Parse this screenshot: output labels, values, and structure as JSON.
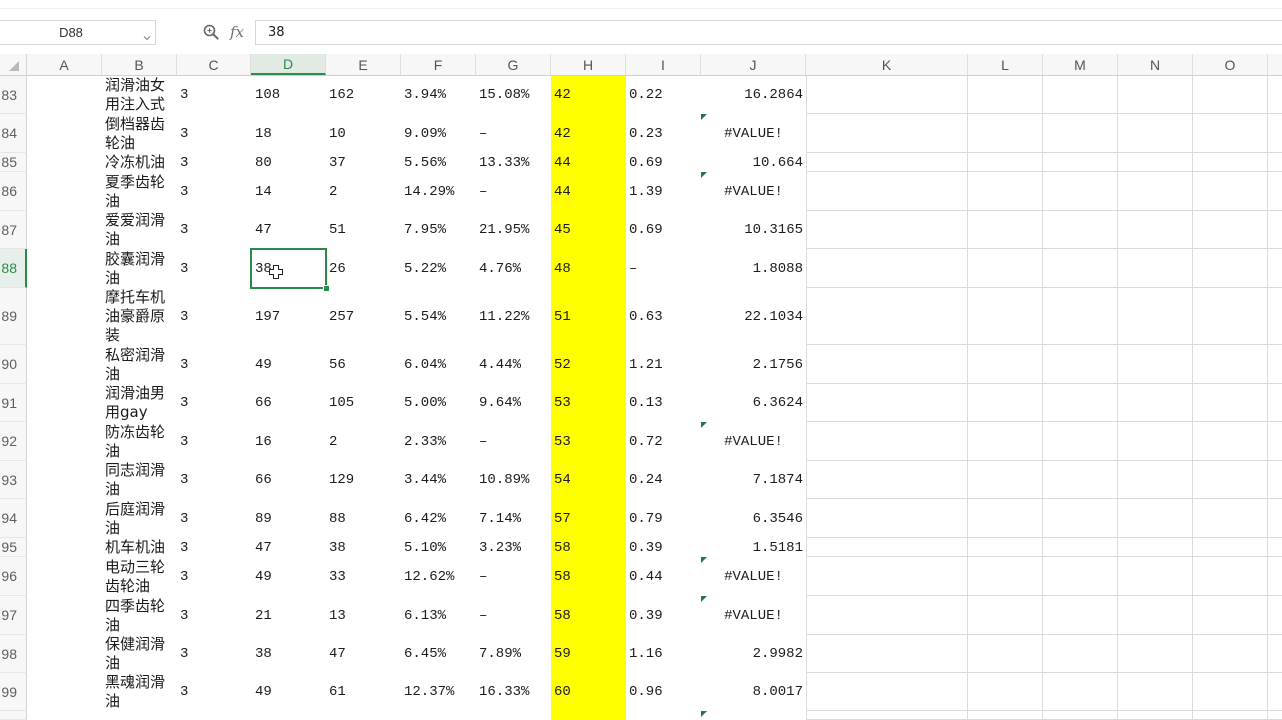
{
  "name_box": {
    "value": "D88"
  },
  "formula_bar": {
    "fx_label": "fx",
    "value": "38"
  },
  "icons": {
    "name_box_dropdown": "chevron-down-icon",
    "zoom": "zoom-icon",
    "select_all": "select-all-triangle-icon",
    "error_indicator": "error-indicator-icon",
    "pointer": "cell-select-cursor-icon"
  },
  "colors": {
    "accent": "#2a8a4a",
    "highlight_fill": "#ffff00",
    "error_indicator": "#1f7a3d"
  },
  "column_headers": [
    "A",
    "B",
    "C",
    "D",
    "E",
    "F",
    "G",
    "H",
    "I",
    "J",
    "K",
    "L",
    "M",
    "N",
    "O"
  ],
  "rows": [
    {
      "row": "83",
      "B": "润滑油女用注入式",
      "C": "3",
      "D": "108",
      "E": "162",
      "F": "3.94%",
      "G": "15.08%",
      "H": "42",
      "I": "0.22",
      "J": "16.2864",
      "flag": false
    },
    {
      "row": "84",
      "B": "倒档器齿轮油",
      "C": "3",
      "D": "18",
      "E": "10",
      "F": "9.09%",
      "G": "–",
      "H": "42",
      "I": "0.23",
      "J": "#VALUE!",
      "flag": true
    },
    {
      "row": "85",
      "B": "冷冻机油",
      "C": "3",
      "D": "80",
      "E": "37",
      "F": "5.56%",
      "G": "13.33%",
      "H": "44",
      "I": "0.69",
      "J": "10.664",
      "flag": false
    },
    {
      "row": "86",
      "B": "夏季齿轮油",
      "C": "3",
      "D": "14",
      "E": "2",
      "F": "14.29%",
      "G": "–",
      "H": "44",
      "I": "1.39",
      "J": "#VALUE!",
      "flag": true
    },
    {
      "row": "87",
      "B": "爱爱润滑油",
      "C": "3",
      "D": "47",
      "E": "51",
      "F": "7.95%",
      "G": "21.95%",
      "H": "45",
      "I": "0.69",
      "J": "10.3165",
      "flag": false
    },
    {
      "row": "88",
      "B": "胶囊润滑油",
      "C": "3",
      "D": "38",
      "E": "26",
      "F": "5.22%",
      "G": "4.76%",
      "H": "48",
      "I": "–",
      "J": "1.8088",
      "flag": false
    },
    {
      "row": "89",
      "B": "摩托车机油豪爵原装",
      "C": "3",
      "D": "197",
      "E": "257",
      "F": "5.54%",
      "G": "11.22%",
      "H": "51",
      "I": "0.63",
      "J": "22.1034",
      "flag": false
    },
    {
      "row": "90",
      "B": "私密润滑油",
      "C": "3",
      "D": "49",
      "E": "56",
      "F": "6.04%",
      "G": "4.44%",
      "H": "52",
      "I": "1.21",
      "J": "2.1756",
      "flag": false
    },
    {
      "row": "91",
      "B": "润滑油男用gay",
      "C": "3",
      "D": "66",
      "E": "105",
      "F": "5.00%",
      "G": "9.64%",
      "H": "53",
      "I": "0.13",
      "J": "6.3624",
      "flag": false
    },
    {
      "row": "92",
      "B": "防冻齿轮油",
      "C": "3",
      "D": "16",
      "E": "2",
      "F": "2.33%",
      "G": "–",
      "H": "53",
      "I": "0.72",
      "J": "#VALUE!",
      "flag": true
    },
    {
      "row": "93",
      "B": "同志润滑油",
      "C": "3",
      "D": "66",
      "E": "129",
      "F": "3.44%",
      "G": "10.89%",
      "H": "54",
      "I": "0.24",
      "J": "7.1874",
      "flag": false
    },
    {
      "row": "94",
      "B": "后庭润滑油",
      "C": "3",
      "D": "89",
      "E": "88",
      "F": "6.42%",
      "G": "7.14%",
      "H": "57",
      "I": "0.79",
      "J": "6.3546",
      "flag": false
    },
    {
      "row": "95",
      "B": "机车机油",
      "C": "3",
      "D": "47",
      "E": "38",
      "F": "5.10%",
      "G": "3.23%",
      "H": "58",
      "I": "0.39",
      "J": "1.5181",
      "flag": false
    },
    {
      "row": "96",
      "B": "电动三轮齿轮油",
      "C": "3",
      "D": "49",
      "E": "33",
      "F": "12.62%",
      "G": "–",
      "H": "58",
      "I": "0.44",
      "J": "#VALUE!",
      "flag": true
    },
    {
      "row": "97",
      "B": "四季齿轮油",
      "C": "3",
      "D": "21",
      "E": "13",
      "F": "6.13%",
      "G": "–",
      "H": "58",
      "I": "0.39",
      "J": "#VALUE!",
      "flag": true
    },
    {
      "row": "98",
      "B": "保健润滑油",
      "C": "3",
      "D": "38",
      "E": "47",
      "F": "6.45%",
      "G": "7.89%",
      "H": "59",
      "I": "1.16",
      "J": "2.9982",
      "flag": false
    },
    {
      "row": "99",
      "B": "黑魂润滑油",
      "C": "3",
      "D": "49",
      "E": "61",
      "F": "12.37%",
      "G": "16.33%",
      "H": "60",
      "I": "0.96",
      "J": "8.0017",
      "flag": false
    },
    {
      "row": "",
      "flag": true
    }
  ]
}
